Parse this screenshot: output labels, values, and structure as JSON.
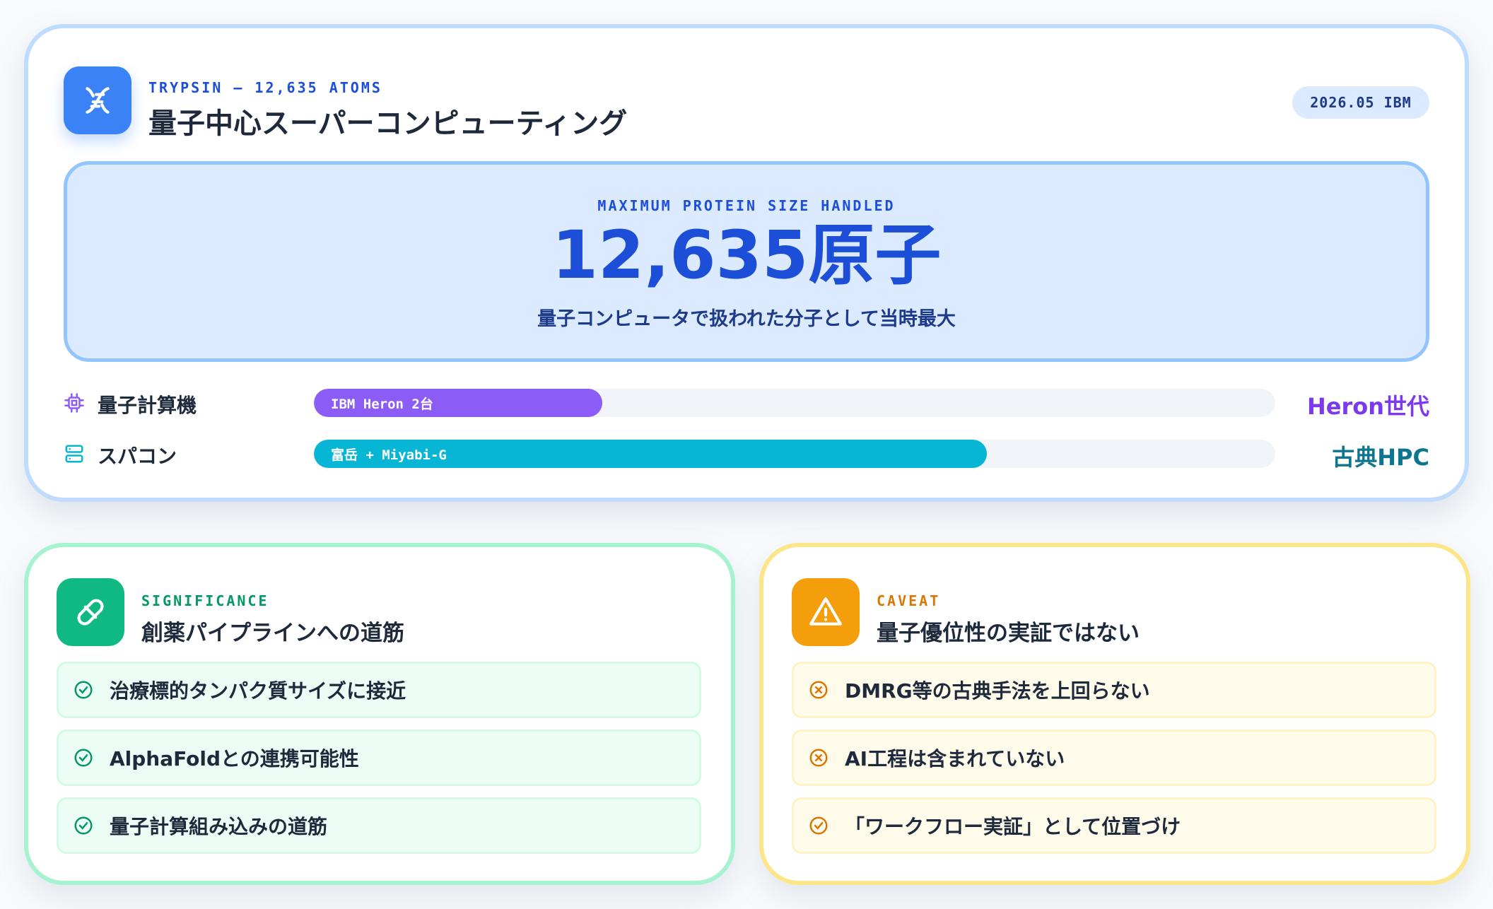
{
  "header": {
    "icon": "dna-icon",
    "eyebrow": "TRYPSIN – 12,635 ATOMS",
    "title": "量子中心スーパーコンピューティング",
    "badge": "2026.05 IBM"
  },
  "hero": {
    "label": "MAXIMUM PROTEIN SIZE HANDLED",
    "value": "12,635原子",
    "subtitle": "量子コンピュータで扱われた分子として当時最大"
  },
  "bars": [
    {
      "icon": "chip-icon",
      "label": "量子計算機",
      "fill_text": "IBM Heron 2台",
      "fill_fraction": 0.3,
      "value": "Heron世代",
      "color": "#8b5cf6",
      "value_color": "#7c3aed"
    },
    {
      "icon": "server-icon",
      "label": "スパコン",
      "fill_text": "富岳 + Miyabi-G",
      "fill_fraction": 0.7,
      "value": "古典HPC",
      "color": "#06b6d4",
      "value_color": "#0e7490"
    }
  ],
  "significance": {
    "icon": "pill-icon",
    "eyebrow": "SIGNIFICANCE",
    "title": "創薬パイプラインへの道筋",
    "accent": "#10b981",
    "eyebrow_color": "#059669",
    "items": [
      {
        "icon": "check-circle-icon",
        "text": "治療標的タンパク質サイズに接近"
      },
      {
        "icon": "check-circle-icon",
        "text": "AlphaFoldとの連携可能性"
      },
      {
        "icon": "check-circle-icon",
        "text": "量子計算組み込みの道筋"
      }
    ]
  },
  "caveat": {
    "icon": "warning-icon",
    "eyebrow": "CAVEAT",
    "title": "量子優位性の実証ではない",
    "accent": "#f59e0b",
    "eyebrow_color": "#d97706",
    "items": [
      {
        "icon": "x-circle-icon",
        "text": "DMRG等の古典手法を上回らない"
      },
      {
        "icon": "x-circle-icon",
        "text": "AI工程は含まれていない"
      },
      {
        "icon": "check-circle-icon",
        "text": "「ワークフロー実証」として位置づけ"
      }
    ]
  }
}
